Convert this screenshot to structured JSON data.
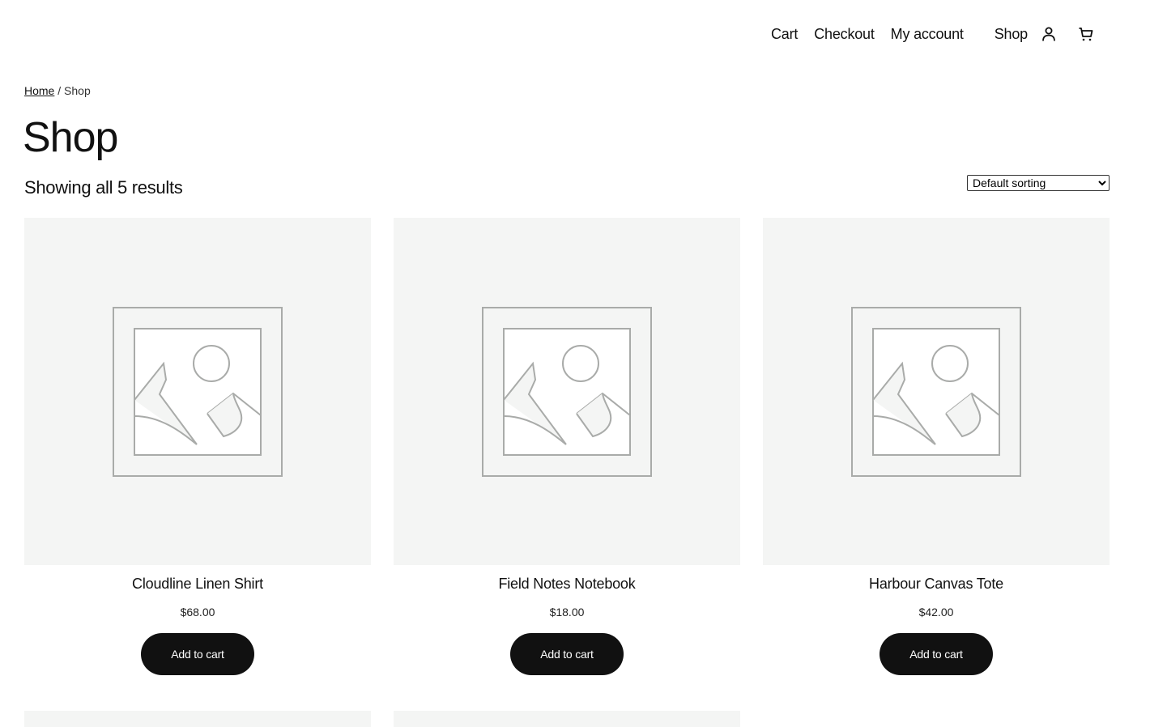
{
  "header": {
    "nav": [
      {
        "label": "Cart"
      },
      {
        "label": "Checkout"
      },
      {
        "label": "My account"
      }
    ],
    "shop_label": "Shop",
    "icons": [
      "account-icon",
      "cart-icon"
    ]
  },
  "breadcrumb": {
    "home": "Home",
    "separator": " / ",
    "current": "Shop"
  },
  "page": {
    "title": "Shop",
    "result_count": "Showing all 5 results",
    "sort_selected": "Default sorting"
  },
  "products": [
    {
      "name": "Cloudline Linen Shirt",
      "price": "$68.00",
      "button": "Add to cart"
    },
    {
      "name": "Field Notes Notebook",
      "price": "$18.00",
      "button": "Add to cart"
    },
    {
      "name": "Harbour Canvas Tote",
      "price": "$42.00",
      "button": "Add to cart"
    }
  ],
  "colors": {
    "text": "#111111",
    "placeholder_bg": "#f4f5f4",
    "placeholder_stroke": "#a9aba9",
    "button_bg": "#111111",
    "button_text": "#ffffff"
  }
}
